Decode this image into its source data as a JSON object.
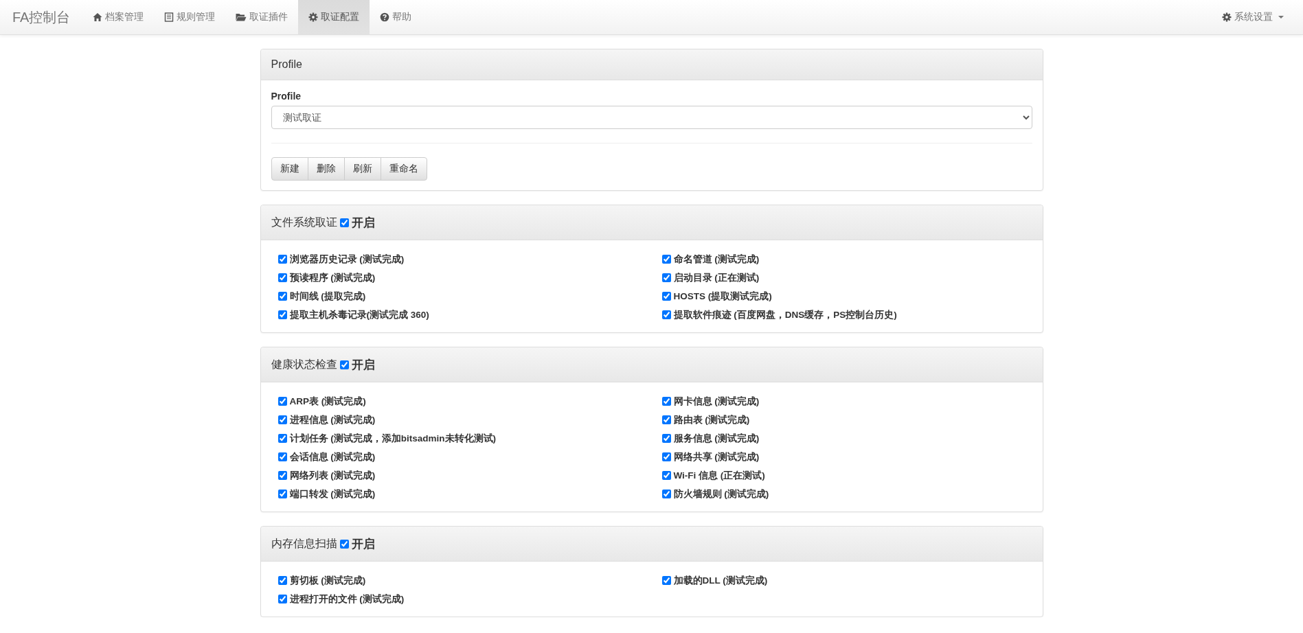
{
  "navbar": {
    "brand": "FA控制台",
    "items": [
      {
        "label": "档案管理",
        "kind": "home",
        "selected": false
      },
      {
        "label": "规则管理",
        "kind": "list",
        "selected": false
      },
      {
        "label": "取证插件",
        "kind": "folder",
        "selected": false
      },
      {
        "label": "取证配置",
        "kind": "gear",
        "selected": true
      },
      {
        "label": "帮助",
        "kind": "question",
        "selected": false
      }
    ],
    "settings": {
      "label": "系统设置",
      "kind": "gear"
    }
  },
  "profile_panel": {
    "title": "Profile",
    "field_label": "Profile",
    "select_value": "测试取证",
    "buttons": [
      "新建",
      "删除",
      "刷新",
      "重命名"
    ]
  },
  "sections": [
    {
      "title": "文件系统取证",
      "enabled": true,
      "enabled_label": "开启",
      "items": [
        {
          "label": "浏览器历史记录 (测试完成)",
          "checked": true
        },
        {
          "label": "命名管道 (测试完成)",
          "checked": true
        },
        {
          "label": "预读程序 (测试完成)",
          "checked": true
        },
        {
          "label": "启动目录 (正在测试)",
          "checked": true
        },
        {
          "label": "时间线 (提取完成)",
          "checked": true
        },
        {
          "label": "HOSTS (提取测试完成)",
          "checked": true
        },
        {
          "label": "提取主机杀毒记录(测试完成 360)",
          "checked": true
        },
        {
          "label": "提取软件痕迹 (百度网盘，DNS缓存，PS控制台历史)",
          "checked": true
        }
      ]
    },
    {
      "title": "健康状态检查",
      "enabled": true,
      "enabled_label": "开启",
      "items": [
        {
          "label": "ARP表 (测试完成)",
          "checked": true
        },
        {
          "label": "网卡信息 (测试完成)",
          "checked": true
        },
        {
          "label": "进程信息 (测试完成)",
          "checked": true
        },
        {
          "label": "路由表 (测试完成)",
          "checked": true
        },
        {
          "label": "计划任务 (测试完成，添加bitsadmin未转化测试)",
          "checked": true
        },
        {
          "label": "服务信息 (测试完成)",
          "checked": true
        },
        {
          "label": "会话信息 (测试完成)",
          "checked": true
        },
        {
          "label": "网络共享 (测试完成)",
          "checked": true
        },
        {
          "label": "网络列表 (测试完成)",
          "checked": true
        },
        {
          "label": "Wi-Fi 信息 (正在测试)",
          "checked": true
        },
        {
          "label": "端口转发 (测试完成)",
          "checked": true
        },
        {
          "label": "防火墙规则 (测试完成)",
          "checked": true
        }
      ]
    },
    {
      "title": "内存信息扫描",
      "enabled": true,
      "enabled_label": "开启",
      "items": [
        {
          "label": "剪切板 (测试完成)",
          "checked": true
        },
        {
          "label": "加载的DLL (测试完成)",
          "checked": true
        },
        {
          "label": "进程打开的文件 (测试完成)",
          "checked": true
        }
      ]
    }
  ]
}
